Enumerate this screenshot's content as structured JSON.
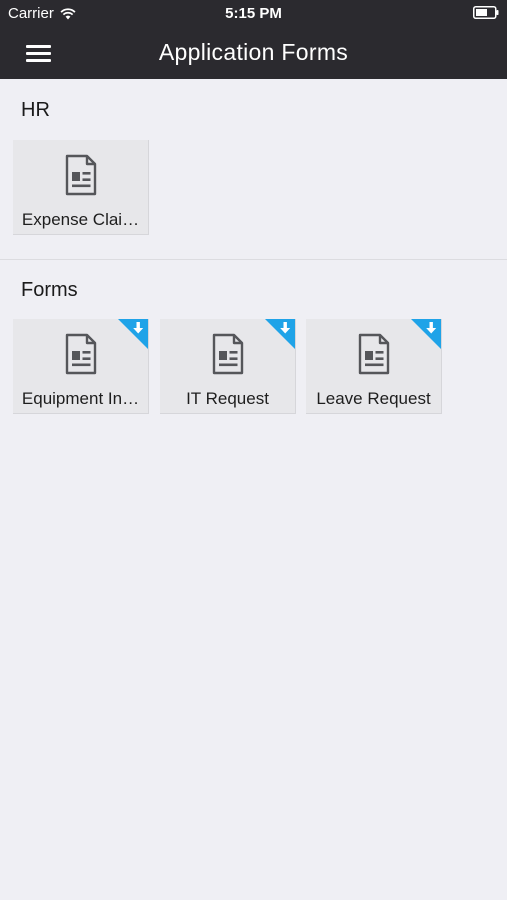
{
  "status_bar": {
    "carrier": "Carrier",
    "time": "5:15 PM"
  },
  "nav": {
    "title": "Application Forms"
  },
  "sections": [
    {
      "title": "HR",
      "items": [
        {
          "label": "Expense Clai…",
          "icon": "document-icon",
          "downloadable": false
        }
      ]
    },
    {
      "title": "Forms",
      "items": [
        {
          "label": "Equipment In…",
          "icon": "document-icon",
          "downloadable": true
        },
        {
          "label": "IT Request",
          "icon": "document-icon",
          "downloadable": true
        },
        {
          "label": "Leave Request",
          "icon": "document-icon",
          "downloadable": true
        }
      ]
    }
  ],
  "colors": {
    "navbar_bg": "#2b2a2f",
    "page_bg": "#efeff4",
    "tile_bg": "#e7e7ea",
    "badge": "#1fa3e8",
    "icon": "#55565a"
  }
}
